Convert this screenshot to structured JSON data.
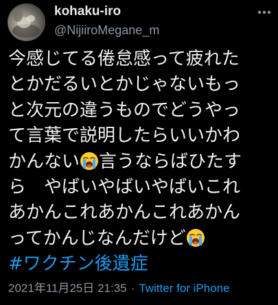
{
  "tweet": {
    "display_name": "kohaku-iro",
    "handle": "@NijiiroMegane_m",
    "lines": [
      "今感じてる倦怠感って疲れた",
      "とかだるいとかじゃないもっ",
      "と次元の違うものでどうやっ",
      "て言葉で説明したらいいかわ",
      "かんない",
      "言うならばひたす",
      "ら　やばいやばいやばいこれ",
      "あかんこれあかんこれあかん",
      "ってかんじなんだけど"
    ],
    "hashtag": "#ワクチン後遺症",
    "timestamp": "2021年11月25日 21:35",
    "separator": "·",
    "source": "Twitter for iPhone",
    "emoji": "loudly-crying-face"
  },
  "colors": {
    "background": "#000000",
    "text": "#e7e9ea",
    "muted": "#8b98a5",
    "accent": "#1d9bf0"
  }
}
